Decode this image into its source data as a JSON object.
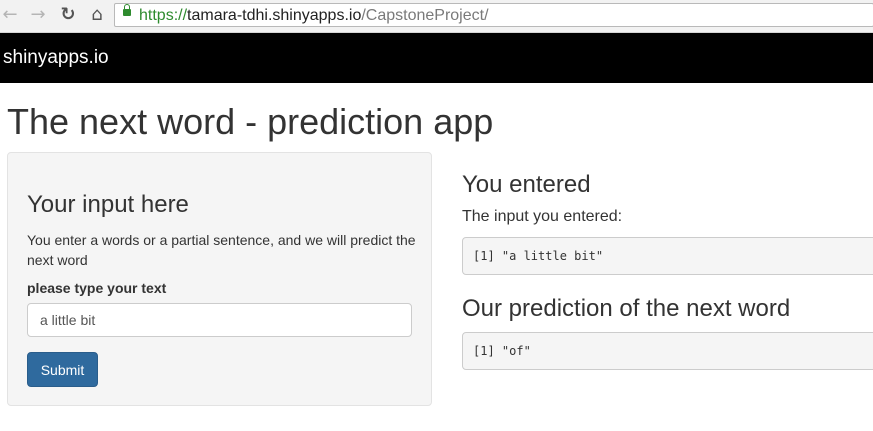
{
  "browser": {
    "url_scheme": "https://",
    "url_host": "tamara-tdhi.shinyapps.io",
    "url_path": "/CapstoneProject/"
  },
  "header": {
    "brand": "shinyapps.io"
  },
  "page": {
    "title": "The next word - prediction app"
  },
  "sidebar": {
    "heading": "Your input here",
    "description": "You enter a words or a partial sentence, and we will predict the next word",
    "input_label": "please type your text",
    "input_value": "a little bit",
    "submit_label": "Submit"
  },
  "main": {
    "entered_heading": "You entered",
    "entered_sub": "The input you entered:",
    "entered_output": "[1] \"a little bit\"",
    "prediction_heading": "Our prediction of the next word",
    "prediction_output": "[1] \"of\""
  }
}
